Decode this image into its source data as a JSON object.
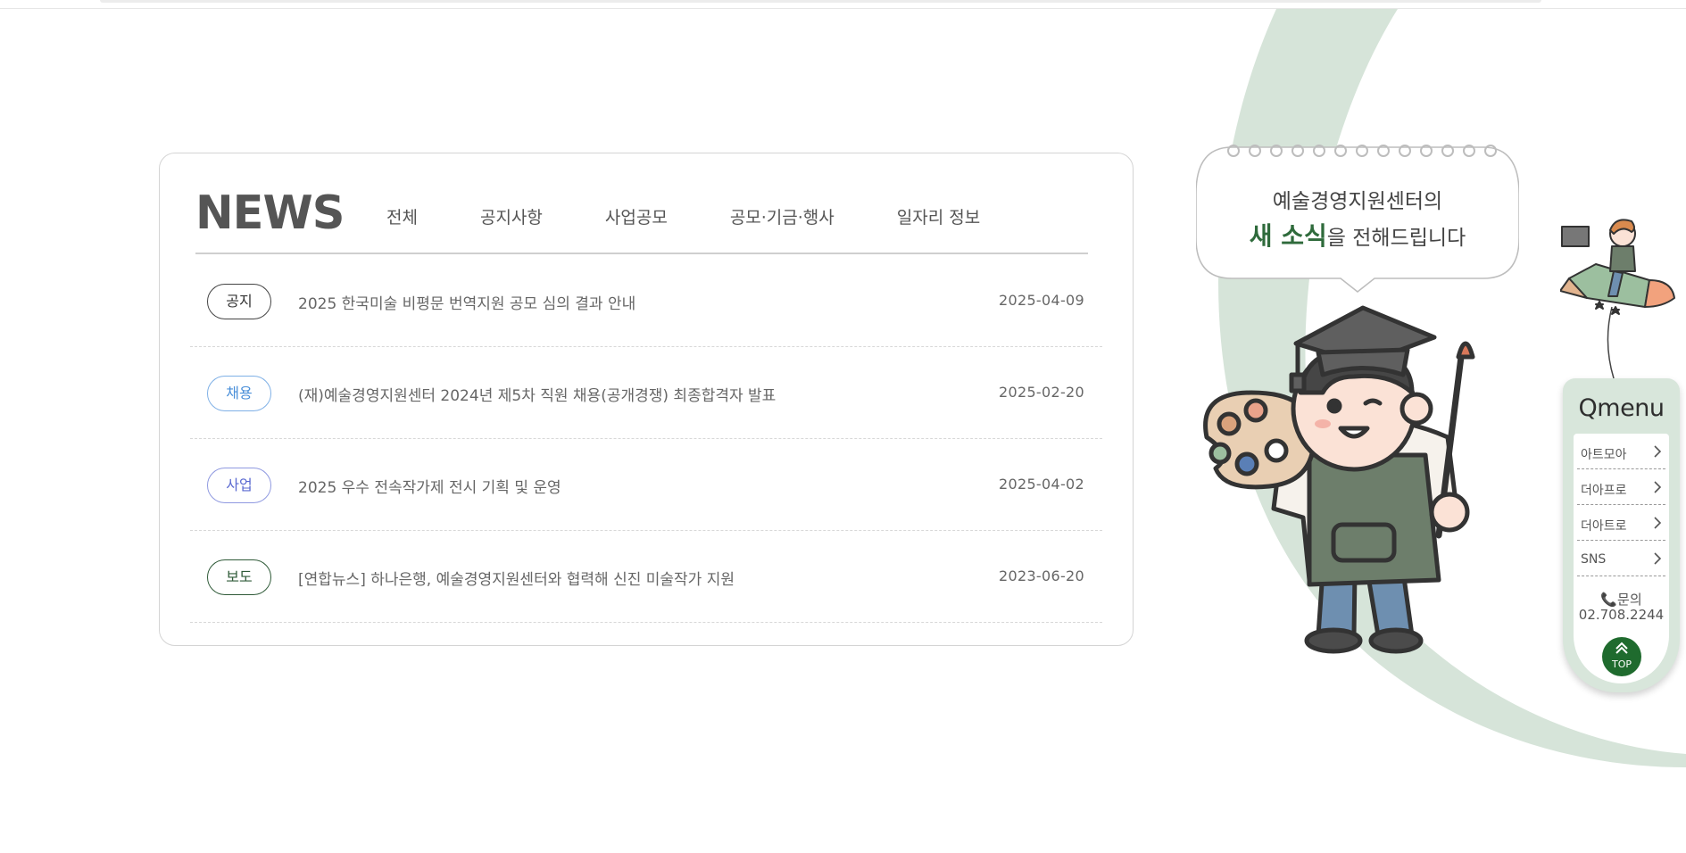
{
  "news": {
    "title": "NEWS",
    "tabs": [
      {
        "label": "전체"
      },
      {
        "label": "공지사항"
      },
      {
        "label": "사업공모"
      },
      {
        "label": "공모·기금·행사"
      },
      {
        "label": "일자리 정보"
      }
    ],
    "items": [
      {
        "badge": "공지",
        "badge_color": "#333333",
        "title": "2025 한국미술 비평문 번역지원 공모 심의 결과 안내",
        "date": "2025-04-09"
      },
      {
        "badge": "채용",
        "badge_color": "#4a8fd9",
        "title": "(재)예술경영지원센터 2024년 제5차 직원 채용(공개경쟁) 최종합격자 발표",
        "date": "2025-02-20"
      },
      {
        "badge": "사업",
        "badge_color": "#5b6ad1",
        "title": "2025 우수 전속작가제 전시 기획 및 운영",
        "date": "2025-04-02"
      },
      {
        "badge": "보도",
        "badge_color": "#2f5a38",
        "title": "[연합뉴스] 하나은행, 예술경영지원센터와 협력해 신진 미술작가 지원",
        "date": "2023-06-20"
      }
    ]
  },
  "bubble": {
    "line1": "예술경영지원센터의",
    "accent": "새 소식",
    "line2_rest": "을 전해드립니다"
  },
  "qmenu": {
    "title": "Qmenu",
    "items": [
      {
        "label": "아트모아"
      },
      {
        "label": "더아프로"
      },
      {
        "label": "더아트로"
      },
      {
        "label": "SNS"
      }
    ],
    "contact_label": "문의",
    "contact_phone": "02.708.2244",
    "top_label": "TOP"
  },
  "colors": {
    "accent_green": "#2f6b3c",
    "arc_green": "#d6e4d9",
    "top_button": "#1f6b2e"
  }
}
